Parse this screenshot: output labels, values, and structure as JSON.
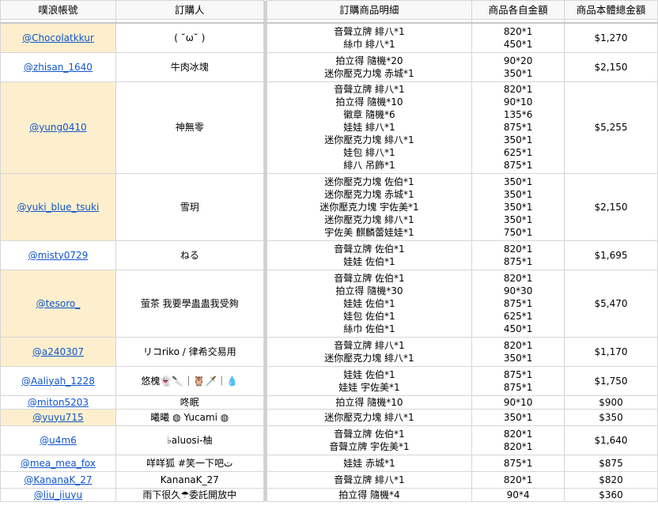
{
  "headers": {
    "account": "噗浪帳號",
    "buyer": "訂購人",
    "items": "訂購商品明細",
    "prices": "商品各自金額",
    "total": "商品本體總金額"
  },
  "orders": [
    {
      "account": "@Chocolatkkur",
      "buyer": "( ˘ω˘ )",
      "highlight": true,
      "items": [
        "音聲立牌 緋八*1",
        "絲巾 緋八*1"
      ],
      "prices": [
        "820*1",
        "450*1"
      ],
      "total": "$1,270"
    },
    {
      "account": "@zhisan_1640",
      "buyer": "牛肉冰塊",
      "highlight": false,
      "items": [
        "拍立得 隨機*20",
        "迷你壓克力塊 赤城*1"
      ],
      "prices": [
        "90*20",
        "350*1"
      ],
      "total": "$2,150"
    },
    {
      "account": "@yung0410",
      "buyer": "神無零",
      "highlight": true,
      "items": [
        "音聲立牌 緋八*1",
        "拍立得 隨機*10",
        "徽章 隨機*6",
        "娃娃 緋八*1",
        "迷你壓克力塊 緋八*1",
        "娃包 緋八*1",
        "緋八 吊飾*1"
      ],
      "prices": [
        "820*1",
        "90*10",
        "135*6",
        "875*1",
        "350*1",
        "625*1",
        "875*1"
      ],
      "total": "$5,255"
    },
    {
      "account": "@yuki_blue_tsuki",
      "buyer": "雪玥",
      "highlight": true,
      "items": [
        "迷你壓克力塊 佐伯*1",
        "迷你壓克力塊 赤城*1",
        "迷你壓克力塊 宇佐美*1",
        "迷你壓克力塊 緋八*1",
        "宇佐美 麒麟蕾娃娃*1"
      ],
      "prices": [
        "350*1",
        "350*1",
        "350*1",
        "350*1",
        "750*1"
      ],
      "total": "$2,150"
    },
    {
      "account": "@misty0729",
      "buyer": "ねる",
      "highlight": false,
      "items": [
        "音聲立牌 佐伯*1",
        "娃娃 佐伯*1"
      ],
      "prices": [
        "820*1",
        "875*1"
      ],
      "total": "$1,695"
    },
    {
      "account": "@tesoro_",
      "buyer": "萤茶 我要學蛊蛊我受夠",
      "highlight": true,
      "items": [
        "音聲立牌 佐伯*1",
        "拍立得 隨機*30",
        "娃娃 佐伯*1",
        "娃包 佐伯*1",
        "絲巾 佐伯*1"
      ],
      "prices": [
        "820*1",
        "90*30",
        "875*1",
        "625*1",
        "450*1"
      ],
      "total": "$5,470"
    },
    {
      "account": "@a240307",
      "buyer": "リコriko / 律希交易用",
      "highlight": true,
      "items": [
        "音聲立牌 緋八*1",
        "迷你壓克力塊 緋八*1"
      ],
      "prices": [
        "820*1",
        "350*1"
      ],
      "total": "$1,170"
    },
    {
      "account": "@Aaliyah_1228",
      "buyer": "悠槐👻🔪｜🦉🗡️｜💧",
      "highlight": false,
      "items": [
        "娃娃 佐伯*1",
        "娃娃 宇佐美*1"
      ],
      "prices": [
        "875*1",
        "875*1"
      ],
      "total": "$1,750"
    },
    {
      "account": "@miton5203",
      "buyer": "咚眠",
      "highlight": false,
      "items": [
        "拍立得 隨機*10"
      ],
      "prices": [
        "90*10"
      ],
      "total": "$900"
    },
    {
      "account": "@yuyu715",
      "buyer": "曦曦 ◍ Yucami ◍",
      "highlight": true,
      "items": [
        "迷你壓克力塊 緋八*1"
      ],
      "prices": [
        "350*1"
      ],
      "total": "$350"
    },
    {
      "account": "@u4m6",
      "buyer": "♭aluosi-柚",
      "highlight": false,
      "items": [
        "音聲立牌 佐伯*1",
        "音聲立牌 宇佐美*1"
      ],
      "prices": [
        "820*1",
        "820*1"
      ],
      "total": "$1,640"
    },
    {
      "account": "@mea_mea_fox",
      "buyer": "咩咩狐 #笑一下吧ت",
      "highlight": false,
      "items": [
        "娃娃 赤城*1"
      ],
      "prices": [
        "875*1"
      ],
      "total": "$875"
    },
    {
      "account": "@KananaK_27",
      "buyer": "KananaK_27",
      "highlight": false,
      "items": [
        "音聲立牌 緋八*1"
      ],
      "prices": [
        "820*1"
      ],
      "total": "$820"
    },
    {
      "account": "@liu_jiuyu",
      "buyer": "雨下很久☂委託開放中",
      "highlight": false,
      "items": [
        "拍立得 隨機*4"
      ],
      "prices": [
        "90*4"
      ],
      "total": "$360"
    }
  ],
  "colors": {
    "highlight": "#fdefcd",
    "link": "#1155cc",
    "header_bg": "#f8f8f8"
  }
}
